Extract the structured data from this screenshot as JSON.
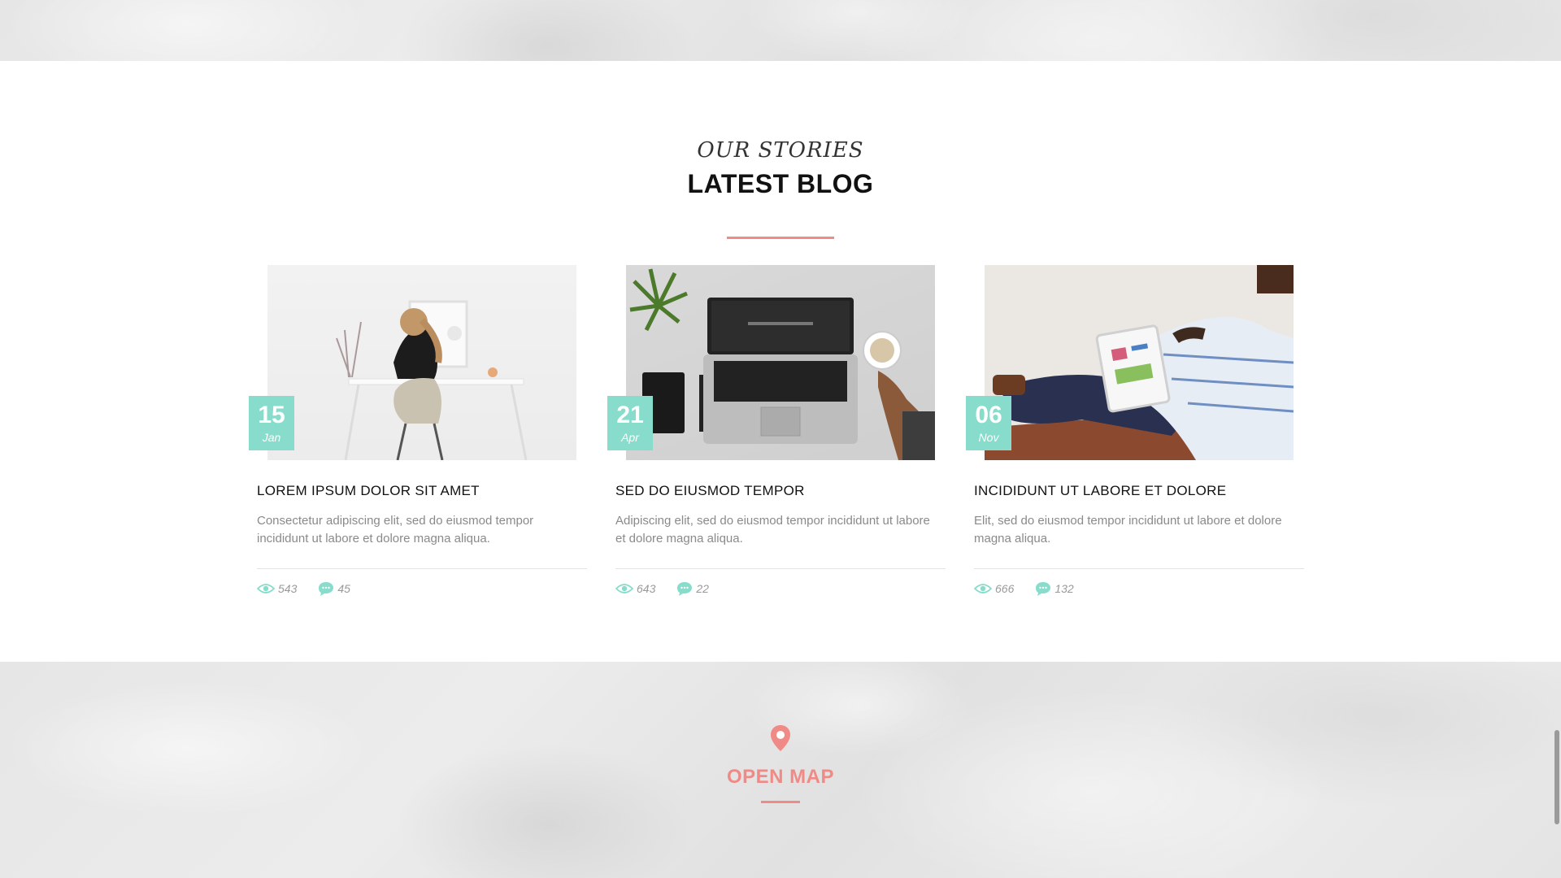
{
  "section": {
    "subtitle": "OUR STORIES",
    "title": "LATEST BLOG",
    "accent_color": "#f08a86",
    "badge_color": "#88dccb"
  },
  "posts": [
    {
      "day": "15",
      "month": "Jan",
      "title": "LOREM IPSUM DOLOR SIT AMET",
      "excerpt": "Consectetur adipiscing elit, sed do eiusmod tempor incididunt ut labore et dolore magna aliqua.",
      "views": "543",
      "comments": "45",
      "image": "woman-at-desk-photo"
    },
    {
      "day": "21",
      "month": "Apr",
      "title": "SED DO EIUSMOD TEMPOR",
      "excerpt": "Adipiscing elit, sed do eiusmod tempor incididunt ut labore et dolore magna aliqua.",
      "views": "643",
      "comments": "22",
      "image": "laptop-coffee-photo"
    },
    {
      "day": "06",
      "month": "Nov",
      "title": "INCIDIDUNT UT LABORE ET DOLORE",
      "excerpt": "Elit, sed do eiusmod tempor incididunt ut labore et dolore magna aliqua.",
      "views": "666",
      "comments": "132",
      "image": "man-with-tablet-photo"
    }
  ],
  "map": {
    "label": "OPEN MAP",
    "icon": "map-pin-icon"
  }
}
